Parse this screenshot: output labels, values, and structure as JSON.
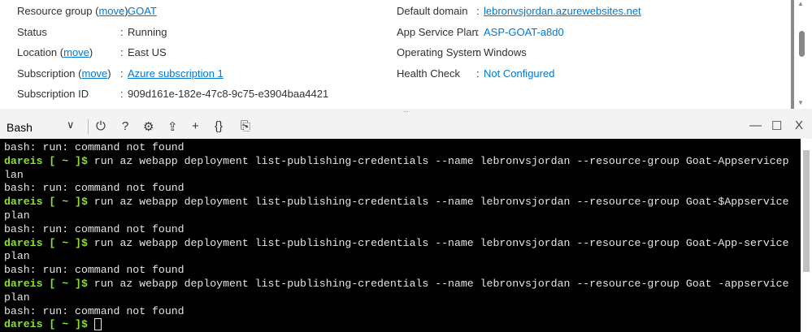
{
  "essentials": {
    "left": [
      {
        "label": "Resource group",
        "move": "move",
        "value": "GOAT",
        "link": true
      },
      {
        "label": "Status",
        "value": "Running"
      },
      {
        "label": "Location",
        "move": "move",
        "value": "East US"
      },
      {
        "label": "Subscription",
        "move": "move",
        "value": "Azure subscription 1",
        "link": true
      },
      {
        "label": "Subscription ID",
        "value": "909d161e-182e-47c8-9c75-e3904baa4421"
      }
    ],
    "right": [
      {
        "label": "Default domain",
        "value": "lebronvsjordan.azurewebsites.net"
      },
      {
        "label": "App Service Plan",
        "value": "ASP-GOAT-a8d0"
      },
      {
        "label": "Operating System",
        "value": "Windows"
      },
      {
        "label": "Health Check",
        "value": "Not Configured"
      }
    ]
  },
  "splitter": "...",
  "toolbar": {
    "shell": "Bash",
    "chevron": "∨",
    "power": "⏻",
    "help": "?",
    "settings": "⚙",
    "upload": "⇪",
    "new_session": "+",
    "editor": "{}",
    "preview": "⎘",
    "minimize": "—",
    "maximize": "☐",
    "close": "X"
  },
  "terminal": {
    "prompt": "dareis [ ~ ]$ ",
    "lines": [
      {
        "t": "bash: run: command not found"
      },
      {
        "p": true,
        "t": "run az webapp deployment list-publishing-credentials --name lebronvsjordan --resource-group Goat-Appservicep"
      },
      {
        "t": "lan"
      },
      {
        "t": "bash: run: command not found"
      },
      {
        "p": true,
        "t": "run az webapp deployment list-publishing-credentials --name lebronvsjordan --resource-group Goat-$Appservice"
      },
      {
        "t": "plan"
      },
      {
        "t": "bash: run: command not found"
      },
      {
        "p": true,
        "t": "run az webapp deployment list-publishing-credentials --name lebronvsjordan --resource-group Goat-App-service"
      },
      {
        "t": "plan"
      },
      {
        "t": "bash: run: command not found"
      },
      {
        "p": true,
        "t": "run az webapp deployment list-publishing-credentials --name lebronvsjordan --resource-group Goat -appservice"
      },
      {
        "t": "plan"
      },
      {
        "t": "bash: run: command not found"
      },
      {
        "p": true,
        "t": ""
      }
    ]
  }
}
